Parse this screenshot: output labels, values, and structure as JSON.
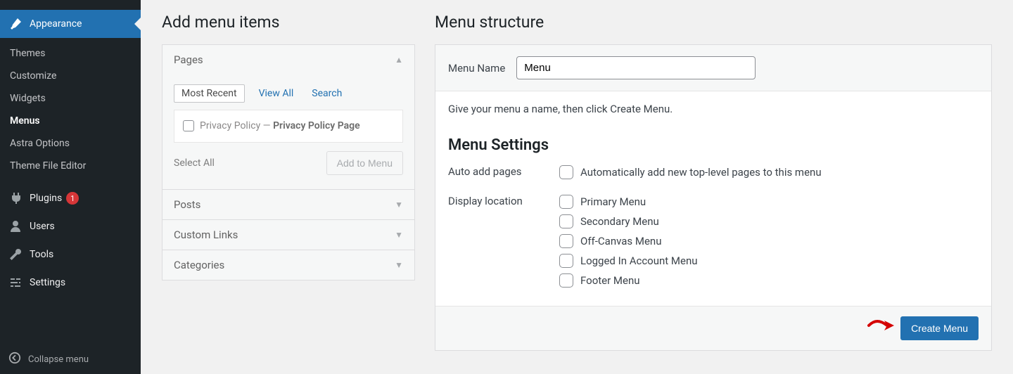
{
  "sidebar": {
    "current": {
      "icon": "paintbrush",
      "label": "Appearance"
    },
    "sub": [
      {
        "label": "Themes"
      },
      {
        "label": "Customize"
      },
      {
        "label": "Widgets"
      },
      {
        "label": "Menus",
        "current": true
      },
      {
        "label": "Astra Options"
      },
      {
        "label": "Theme File Editor"
      }
    ],
    "items": [
      {
        "icon": "plug",
        "label": "Plugins",
        "badge": "1"
      },
      {
        "icon": "user",
        "label": "Users"
      },
      {
        "icon": "wrench",
        "label": "Tools"
      },
      {
        "icon": "sliders",
        "label": "Settings"
      }
    ],
    "collapse_label": "Collapse menu"
  },
  "left": {
    "title": "Add menu items",
    "sections": {
      "pages": {
        "label": "Pages",
        "open": true,
        "tabs": [
          "Most Recent",
          "View All",
          "Search"
        ],
        "active_tab": "Most Recent",
        "items": [
          {
            "text_before": "Privacy Policy — ",
            "text_strong": "Privacy Policy Page"
          }
        ],
        "select_all": "Select All",
        "add_button": "Add to Menu"
      },
      "posts": {
        "label": "Posts"
      },
      "custom": {
        "label": "Custom Links"
      },
      "categories": {
        "label": "Categories"
      }
    }
  },
  "right": {
    "title": "Menu structure",
    "name_label": "Menu Name",
    "name_value": "Menu",
    "hint": "Give your menu a name, then click Create Menu.",
    "settings_title": "Menu Settings",
    "auto_add": {
      "label": "Auto add pages",
      "option": "Automatically add new top-level pages to this menu"
    },
    "display_location": {
      "label": "Display location",
      "options": [
        "Primary Menu",
        "Secondary Menu",
        "Off-Canvas Menu",
        "Logged In Account Menu",
        "Footer Menu"
      ]
    },
    "create_button": "Create Menu"
  }
}
